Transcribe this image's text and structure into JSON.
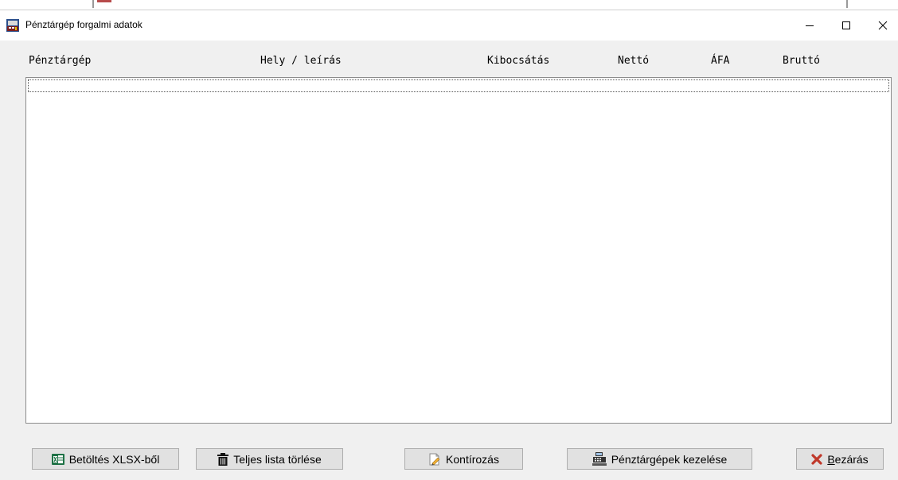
{
  "window": {
    "title": "Pénztárgép forgalmi adatok",
    "controls": {
      "minimize": "—",
      "maximize": "☐",
      "close": "✕"
    }
  },
  "columns": [
    "Pénztárgép",
    "Hely / leírás",
    "Kibocsátás",
    "Nettó",
    "ÁFA",
    "Bruttó"
  ],
  "list": {
    "rows": []
  },
  "buttons": {
    "load_xlsx": {
      "label": "Betöltés XLSX-ből",
      "icon": "excel-icon"
    },
    "clear_list": {
      "label": "Teljes lista törlése",
      "icon": "trash-icon"
    },
    "kontirozas": {
      "label": "Kontírozás",
      "icon": "edit-document-icon"
    },
    "manage_registers": {
      "label": "Pénztárgépek kezelése",
      "icon": "cash-register-icon"
    },
    "close": {
      "mnemonic": "B",
      "label_rest": "ezárás",
      "icon": "red-x-icon"
    }
  },
  "colors": {
    "excel_green": "#1e7145",
    "close_x_red": "#c0392b",
    "button_face": "#e1e1e1",
    "window_bg": "#f0f0f0"
  }
}
